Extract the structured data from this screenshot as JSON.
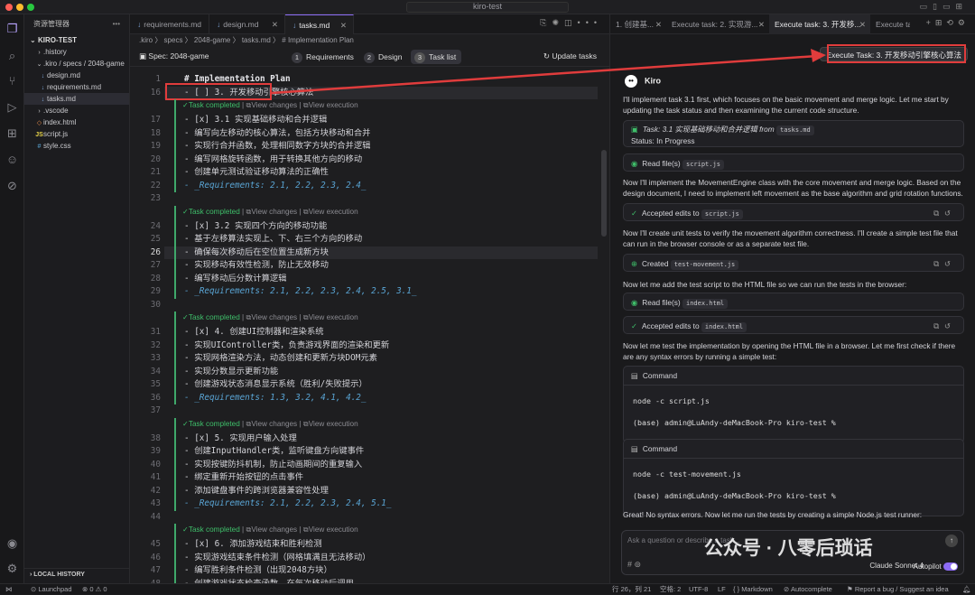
{
  "window": {
    "title": "kiro-test"
  },
  "explorer": {
    "title": "资源管理器",
    "root": "KIRO-TEST",
    "items": [
      {
        "label": ".history",
        "icon": "folder-icon"
      },
      {
        "label": ".kiro / specs / 2048-game",
        "icon": "folder-icon"
      },
      {
        "label": "design.md",
        "icon": "markdown-file-icon"
      },
      {
        "label": "requirements.md",
        "icon": "markdown-file-icon"
      },
      {
        "label": "tasks.md",
        "icon": "markdown-file-icon"
      },
      {
        "label": ".vscode",
        "icon": "folder-icon"
      },
      {
        "label": "index.html",
        "icon": "html-file-icon"
      },
      {
        "label": "script.js",
        "icon": "js-file-icon"
      },
      {
        "label": "style.css",
        "icon": "css-file-icon"
      }
    ],
    "local_history": "LOCAL HISTORY"
  },
  "editor": {
    "tabs": [
      {
        "label": "requirements.md"
      },
      {
        "label": "design.md"
      },
      {
        "label": "tasks.md"
      }
    ],
    "breadcrumb": ".kiro 〉 specs 〉 2048-game 〉 tasks.md 〉 # Implementation Plan",
    "spec_label": "Spec: 2048-game",
    "steps": [
      {
        "num": "1",
        "label": "Requirements"
      },
      {
        "num": "2",
        "label": "Design"
      },
      {
        "num": "3",
        "label": "Task list"
      }
    ],
    "update_label": "Update tasks",
    "codelens": {
      "completed": "Task completed",
      "view_changes": "View changes",
      "sep": "|",
      "view_execution": "View execution"
    },
    "lines": [
      {
        "n": "1",
        "t": "# Implementation Plan",
        "k": "h"
      },
      {
        "n": "16",
        "t": "- [ ] 3. 开发移动引擎核心算法",
        "k": "n"
      },
      {
        "n": "17",
        "t": "- [x] 3.1 实现基础移动和合并逻辑",
        "k": "n"
      },
      {
        "n": "18",
        "t": "  - 编写向左移动的核心算法，包括方块移动和合并",
        "k": "n"
      },
      {
        "n": "19",
        "t": "  - 实现行合并函数，处理相同数字方块的合并逻辑",
        "k": "n"
      },
      {
        "n": "20",
        "t": "  - 编写网格旋转函数，用于转换其他方向的移动",
        "k": "n"
      },
      {
        "n": "21",
        "t": "  - 创建单元测试验证移动算法的正确性",
        "k": "n"
      },
      {
        "n": "22",
        "t": "  - _Requirements: 2.1, 2.2, 2.3, 2.4_",
        "k": "req"
      },
      {
        "n": "23",
        "t": "",
        "k": "n"
      },
      {
        "n": "24",
        "t": "- [x] 3.2 实现四个方向的移动功能",
        "k": "n"
      },
      {
        "n": "25",
        "t": "  - 基于左移算法实现上、下、右三个方向的移动",
        "k": "n"
      },
      {
        "n": "26",
        "t": "  - 确保每次移动后在空位置生成新方块",
        "k": "n"
      },
      {
        "n": "27",
        "t": "  - 实现移动有效性检测，防止无效移动",
        "k": "n"
      },
      {
        "n": "28",
        "t": "  - 编写移动后分数计算逻辑",
        "k": "n"
      },
      {
        "n": "29",
        "t": "  - _Requirements: 2.1, 2.2, 2.3, 2.4, 2.5, 3.1_",
        "k": "req"
      },
      {
        "n": "30",
        "t": "",
        "k": "n"
      },
      {
        "n": "31",
        "t": "- [x] 4. 创建UI控制器和渲染系统",
        "k": "n"
      },
      {
        "n": "32",
        "t": "  - 实现UIController类，负责游戏界面的渲染和更新",
        "k": "n"
      },
      {
        "n": "33",
        "t": "  - 实现网格渲染方法，动态创建和更新方块DOM元素",
        "k": "n"
      },
      {
        "n": "34",
        "t": "  - 实现分数显示更新功能",
        "k": "n"
      },
      {
        "n": "35",
        "t": "  - 创建游戏状态消息显示系统（胜利/失败提示）",
        "k": "n"
      },
      {
        "n": "36",
        "t": "  - _Requirements: 1.3, 3.2, 4.1, 4.2_",
        "k": "req"
      },
      {
        "n": "37",
        "t": "",
        "k": "n"
      },
      {
        "n": "38",
        "t": "- [x] 5. 实现用户输入处理",
        "k": "n"
      },
      {
        "n": "39",
        "t": "  - 创建InputHandler类，监听键盘方向键事件",
        "k": "n"
      },
      {
        "n": "40",
        "t": "  - 实现按键防抖机制，防止动画期间的重复输入",
        "k": "n"
      },
      {
        "n": "41",
        "t": "  - 绑定重新开始按钮的点击事件",
        "k": "n"
      },
      {
        "n": "42",
        "t": "  - 添加键盘事件的跨浏览器兼容性处理",
        "k": "n"
      },
      {
        "n": "43",
        "t": "  - _Requirements: 2.1, 2.2, 2.3, 2.4, 5.1_",
        "k": "req"
      },
      {
        "n": "44",
        "t": "",
        "k": "n"
      },
      {
        "n": "45",
        "t": "- [x] 6. 添加游戏结束和胜利检测",
        "k": "n"
      },
      {
        "n": "46",
        "t": "  - 实现游戏结束条件检测（网格填满且无法移动）",
        "k": "n"
      },
      {
        "n": "47",
        "t": "  - 编写胜利条件检测（出现2048方块）",
        "k": "n"
      },
      {
        "n": "48",
        "t": "  - 创建游戏状态检查函数，在每次移动后调用",
        "k": "n"
      }
    ]
  },
  "chat": {
    "tabs": [
      {
        "label": "1. 创建基..."
      },
      {
        "label": "Execute task: 2. 实现游..."
      },
      {
        "label": "Execute task: 3. 开发移..."
      },
      {
        "label": "Execute ta"
      }
    ],
    "tooltip": "Execute Task: 3. 开发移动引擎核心算法",
    "agent_name": "Kiro",
    "msg1": "I'll implement task 3.1 first, which focuses on the basic movement and merge logic. Let me start by updating the task status and then examining the current code structure.",
    "task_card": {
      "prefix": "Task: 3.1 实现基础移动和合并逻辑 from",
      "file": "tasks.md",
      "status": "Status: In Progress"
    },
    "read1": {
      "label": "Read file(s)",
      "file": "script.js"
    },
    "msg2": "Now I'll implement the MovementEngine class with the core movement and merge logic. Based on the design document, I need to implement left movement as the base algorithm and grid rotation functions.",
    "accepted1": {
      "label": "Accepted edits to",
      "file": "script.js"
    },
    "msg3": "Now I'll create unit tests to verify the movement algorithm correctness. I'll create a simple test file that can run in the browser console or as a separate test file.",
    "created": {
      "label": "Created",
      "file": "test-movement.js"
    },
    "msg4": "Now let me add the test script to the HTML file so we can run the tests in the browser:",
    "read2": {
      "label": "Read file(s)",
      "file": "index.html"
    },
    "accepted2": {
      "label": "Accepted edits to",
      "file": "index.html"
    },
    "msg5": "Now let me test the implementation by opening the HTML file in a browser. Let me first check if there are any syntax errors by running a simple test:",
    "cmd1": {
      "label": "Command",
      "line1": "node -c script.js",
      "line2": "(base) admin@LuAndy-deMacBook-Pro kiro-test %"
    },
    "cmd2": {
      "label": "Command",
      "line1": "node -c test-movement.js",
      "line2": "(base) admin@LuAndy-deMacBook-Pro kiro-test %"
    },
    "msg6": "Great! No syntax errors. Now let me run the tests by creating a simple Node.js test runner:",
    "input_placeholder": "Ask a question or describe a task...",
    "model": "Claude Sonnet 4",
    "autopilot": "Autopilot",
    "watermark": "公众号 · 八零后琐话"
  },
  "status": {
    "launchpad": "Launchpad",
    "problems": "⊗ 0 ⚠ 0",
    "position": "行 26，列 21",
    "spaces": "空格: 2",
    "encoding": "UTF-8",
    "eol": "LF",
    "lang": "Markdown",
    "autocomplete": "Autocomplete",
    "report": "Report a bug / Suggest an idea"
  },
  "colors": {
    "accent": "#8d6cf5",
    "annotation": "#e03c3c",
    "success": "#3fbf6a"
  }
}
